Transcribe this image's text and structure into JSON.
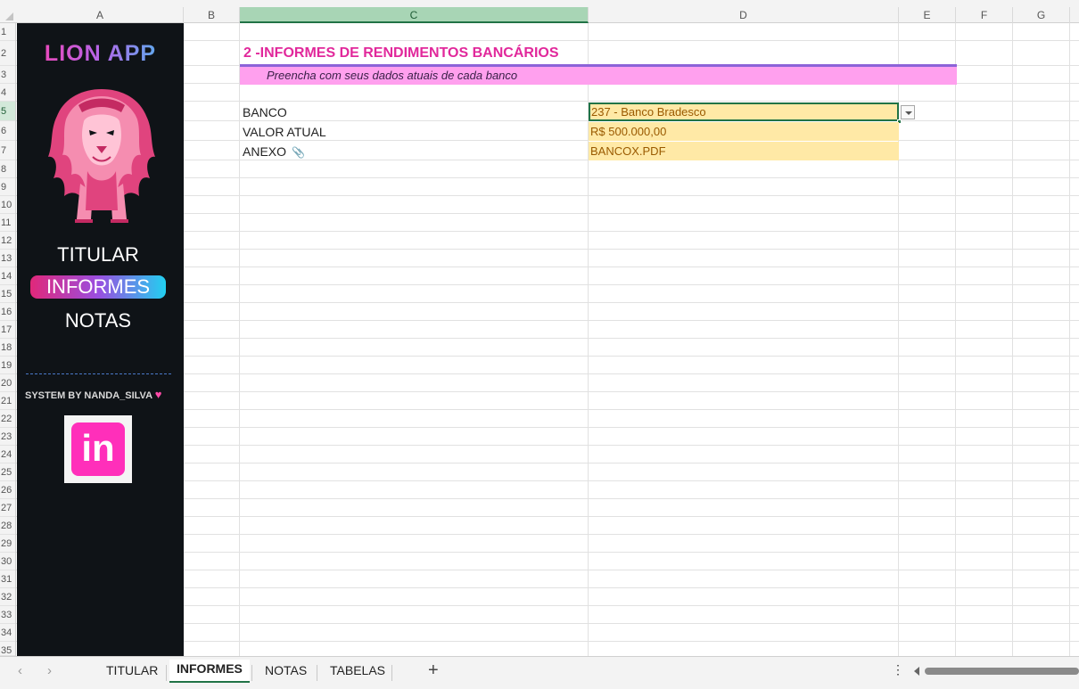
{
  "columns": [
    "A",
    "B",
    "C",
    "D",
    "E",
    "F",
    "G"
  ],
  "rows": [
    "1",
    "2",
    "3",
    "4",
    "5",
    "6",
    "7",
    "8",
    "9",
    "10",
    "11",
    "12",
    "13",
    "14",
    "15",
    "16",
    "17",
    "18",
    "19",
    "20",
    "21",
    "22",
    "23",
    "24",
    "25",
    "26",
    "27",
    "28",
    "29",
    "30",
    "31",
    "32",
    "33",
    "34",
    "35"
  ],
  "sidebar": {
    "app_title": "LION APP",
    "nav": [
      {
        "label": "TITULAR"
      },
      {
        "label": "INFORMES"
      },
      {
        "label": "NOTAS"
      }
    ],
    "credit": "SYSTEM BY NANDA_SILVA",
    "credit_icon": "heart-icon",
    "linkedin_text": "in",
    "logo_icon": "lion-logo-icon",
    "linkedin_icon": "linkedin-icon"
  },
  "content": {
    "title": "2 -INFORMES DE RENDIMENTOS BANCÁRIOS",
    "subtitle": "Preencha com seus dados atuais de cada banco",
    "fields": [
      {
        "label": "BANCO",
        "value": "237 - Banco Bradesco"
      },
      {
        "label": "VALOR ATUAL",
        "value": "R$ 500.000,00"
      },
      {
        "label": "ANEXO",
        "value": "BANCOX.PDF"
      }
    ],
    "attach_icon": "paperclip-icon"
  },
  "tabs": {
    "sheets": [
      {
        "label": "TITULAR"
      },
      {
        "label": "INFORMES"
      },
      {
        "label": "NOTAS"
      },
      {
        "label": "TABELAS"
      }
    ],
    "add_label": "+",
    "more_label": "⋮"
  },
  "colors": {
    "accent_pink": "#e1289b",
    "sidebar_bg": "#0f1317",
    "subtitle_bg": "#ffa0ee",
    "input_bg": "#ffe9a6",
    "excel_green": "#217346"
  }
}
